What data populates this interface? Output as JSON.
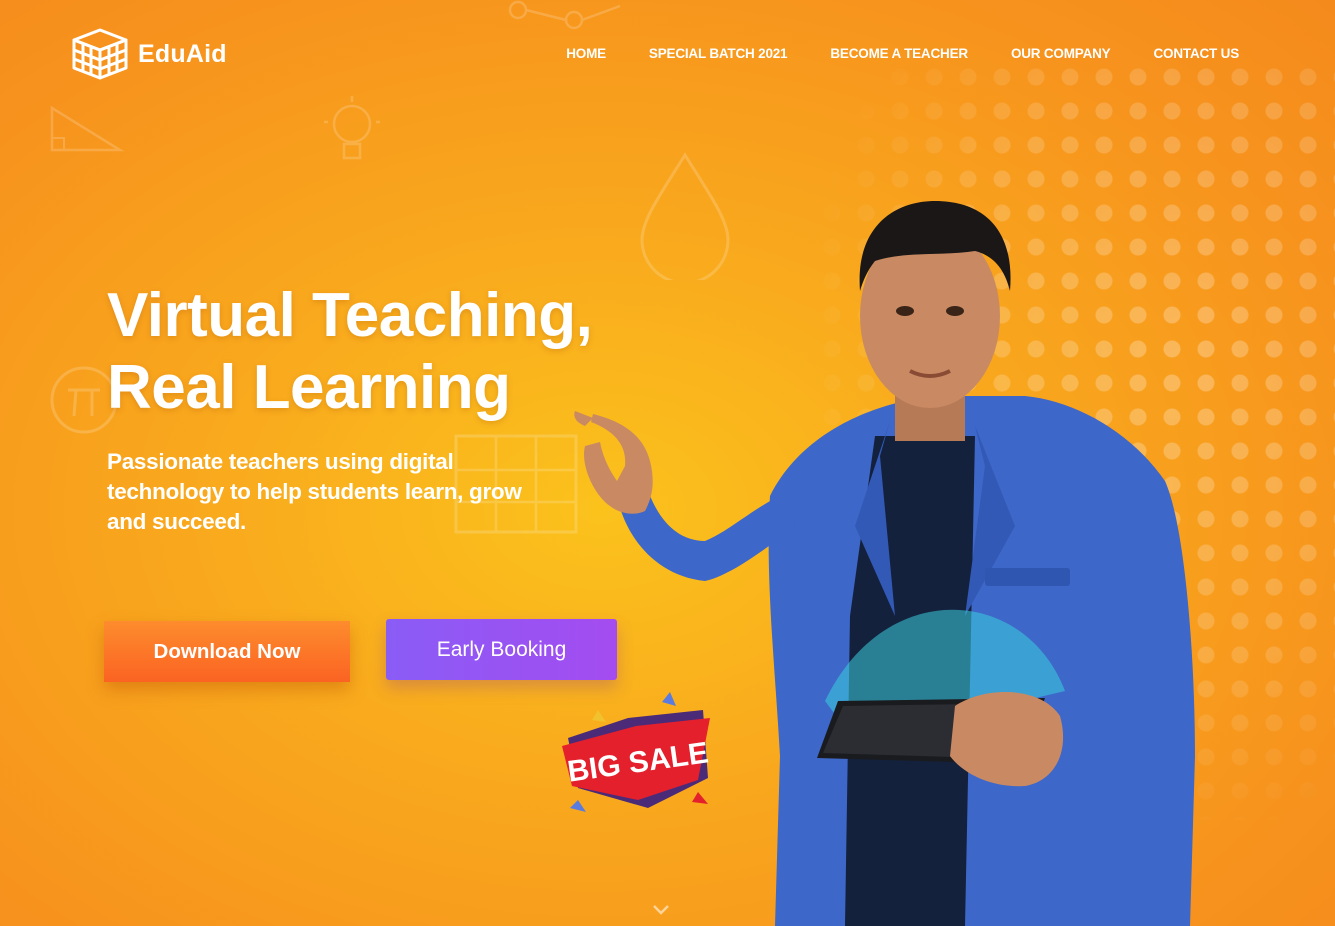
{
  "brand": {
    "name": "EduAid"
  },
  "nav": {
    "items": [
      {
        "label": "HOME"
      },
      {
        "label": "SPECIAL BATCH 2021"
      },
      {
        "label": "BECOME A TEACHER"
      },
      {
        "label": "OUR COMPANY"
      },
      {
        "label": "CONTACT US"
      }
    ]
  },
  "hero": {
    "title_line1": "Virtual Teaching,",
    "title_line2": "Real Learning",
    "subtitle": "Passionate teachers using digital technology to help students learn, grow and succeed.",
    "primary_button": "Download Now",
    "secondary_button": "Early Booking"
  },
  "badge": {
    "text": "BIG SALE"
  },
  "icons": {
    "logo": "cube-stack-icon",
    "scroll": "chevron-down-icon",
    "doodles": [
      "triangle-icon",
      "lightbulb-icon",
      "h2o-drop-icon",
      "pi-icon",
      "network-icon",
      "abacus-icon"
    ]
  },
  "colors": {
    "background": "#f9ab1d",
    "download_button": "#fb6f26",
    "booking_button": "#9255f4",
    "sale_red": "#e3202c",
    "sale_purple": "#4b2a78",
    "jacket_blue": "#3d67c8"
  }
}
